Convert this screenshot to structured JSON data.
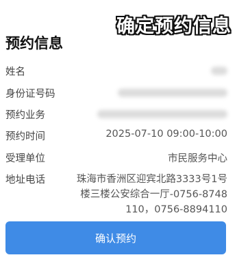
{
  "overlay": {
    "caption": "确定预约信息"
  },
  "page": {
    "title": "预约信息"
  },
  "fields": {
    "name_label": "姓名",
    "id_label": "身份证号码",
    "business_label": "预约业务",
    "time_label": "预约时间",
    "time_value": "2025-07-10 09:00-10:00",
    "unit_label": "受理单位",
    "unit_value": "市民服务中心",
    "address_label": "地址电话",
    "address_line1": "珠海市香洲区迎宾北路3333号1号",
    "address_line2": "楼三楼公安综合一厅-0756-8748",
    "address_line3": "110，0756-8894110"
  },
  "actions": {
    "confirm_label": "确认预约"
  },
  "colors": {
    "primary": "#3f8be6"
  }
}
